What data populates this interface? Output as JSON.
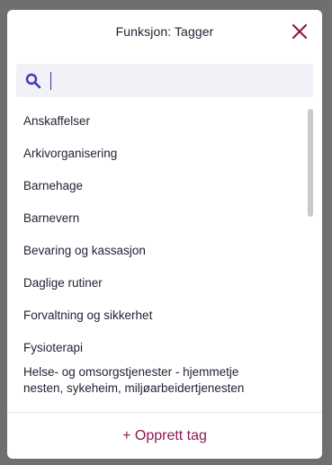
{
  "modal": {
    "title": "Funksjon: Tagger"
  },
  "search": {
    "placeholder": "",
    "value": ""
  },
  "tags": [
    "Anskaffelser",
    "Arkivorganisering",
    "Barnehage",
    "Barnevern",
    "Bevaring og kassasjon",
    "Daglige rutiner",
    "Forvaltning og sikkerhet",
    "Fysioterapi",
    "Helse- og omsorgstjenester - hjemmetje nesten, sykeheim, miljøarbeidertjenesten"
  ],
  "footer": {
    "create_label": "+ Opprett tag"
  },
  "colors": {
    "accent": "#8c1a4f",
    "search_icon": "#3b3bb3",
    "search_bg": "#f1f1f7",
    "text": "#1f2033"
  },
  "icons": {
    "close": "close-icon",
    "search": "search-icon"
  }
}
